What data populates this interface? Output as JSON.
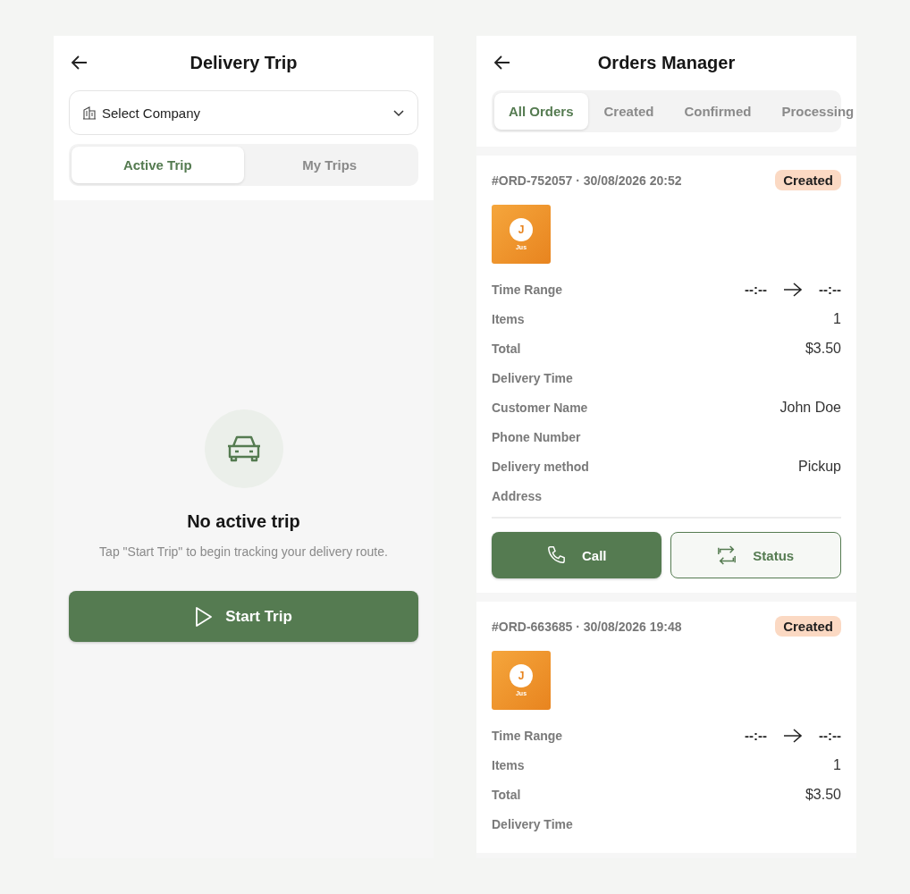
{
  "delivery_trip": {
    "title": "Delivery Trip",
    "company_select": {
      "placeholder": "Select Company"
    },
    "tabs": [
      {
        "label": "Active Trip",
        "selected": true
      },
      {
        "label": "My Trips",
        "selected": false
      }
    ],
    "empty_state": {
      "title": "No active trip",
      "message": "Tap \"Start Trip\" to begin tracking your delivery route."
    },
    "start_button": "Start Trip"
  },
  "orders_manager": {
    "title": "Orders Manager",
    "tabs": [
      {
        "label": "All Orders",
        "selected": true
      },
      {
        "label": "Created",
        "selected": false
      },
      {
        "label": "Confirmed",
        "selected": false
      },
      {
        "label": "Processing",
        "selected": false
      }
    ],
    "orders": [
      {
        "header": "#ORD-752057 · 30/08/2026 20:52",
        "status": "Created",
        "thumb": {
          "initial": "J",
          "caption": "Jus"
        },
        "rows": [
          {
            "kind": "range",
            "label": "Time Range",
            "from": "--:--",
            "to": "--:--"
          },
          {
            "kind": "text",
            "label": "Items",
            "value": "1"
          },
          {
            "kind": "text",
            "label": "Total",
            "value": "$3.50"
          },
          {
            "kind": "text",
            "label": "Delivery Time"
          },
          {
            "kind": "text",
            "label": "Customer Name",
            "value": "John Doe"
          },
          {
            "kind": "text",
            "label": "Phone Number"
          },
          {
            "kind": "text",
            "label": "Delivery method",
            "value": "Pickup"
          },
          {
            "kind": "text",
            "label": "Address"
          }
        ],
        "actions": [
          "Call",
          "Status"
        ]
      },
      {
        "header": "#ORD-663685 · 30/08/2026 19:48",
        "status": "Created",
        "thumb": {
          "initial": "J",
          "caption": "Jus"
        },
        "rows": [
          {
            "kind": "range",
            "label": "Time Range",
            "from": "--:--",
            "to": "--:--"
          },
          {
            "kind": "text",
            "label": "Items",
            "value": "1"
          },
          {
            "kind": "text",
            "label": "Total",
            "value": "$3.50"
          },
          {
            "kind": "text",
            "label": "Delivery Time"
          }
        ]
      }
    ]
  }
}
